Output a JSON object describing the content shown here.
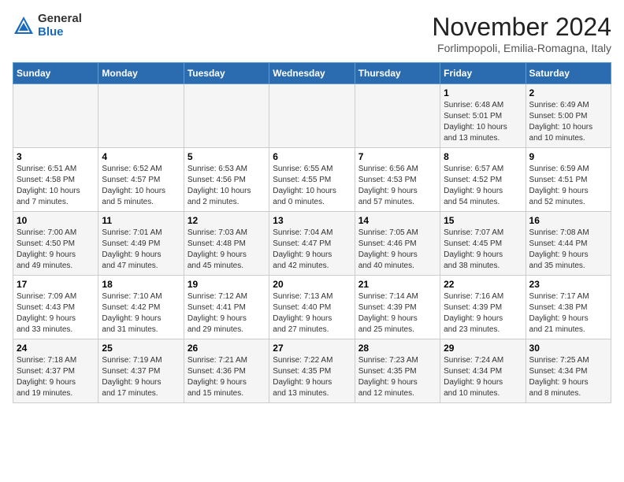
{
  "header": {
    "logo_general": "General",
    "logo_blue": "Blue",
    "month_title": "November 2024",
    "location": "Forlimpopoli, Emilia-Romagna, Italy"
  },
  "days_of_week": [
    "Sunday",
    "Monday",
    "Tuesday",
    "Wednesday",
    "Thursday",
    "Friday",
    "Saturday"
  ],
  "weeks": [
    [
      {
        "day": "",
        "info": ""
      },
      {
        "day": "",
        "info": ""
      },
      {
        "day": "",
        "info": ""
      },
      {
        "day": "",
        "info": ""
      },
      {
        "day": "",
        "info": ""
      },
      {
        "day": "1",
        "info": "Sunrise: 6:48 AM\nSunset: 5:01 PM\nDaylight: 10 hours\nand 13 minutes."
      },
      {
        "day": "2",
        "info": "Sunrise: 6:49 AM\nSunset: 5:00 PM\nDaylight: 10 hours\nand 10 minutes."
      }
    ],
    [
      {
        "day": "3",
        "info": "Sunrise: 6:51 AM\nSunset: 4:58 PM\nDaylight: 10 hours\nand 7 minutes."
      },
      {
        "day": "4",
        "info": "Sunrise: 6:52 AM\nSunset: 4:57 PM\nDaylight: 10 hours\nand 5 minutes."
      },
      {
        "day": "5",
        "info": "Sunrise: 6:53 AM\nSunset: 4:56 PM\nDaylight: 10 hours\nand 2 minutes."
      },
      {
        "day": "6",
        "info": "Sunrise: 6:55 AM\nSunset: 4:55 PM\nDaylight: 10 hours\nand 0 minutes."
      },
      {
        "day": "7",
        "info": "Sunrise: 6:56 AM\nSunset: 4:53 PM\nDaylight: 9 hours\nand 57 minutes."
      },
      {
        "day": "8",
        "info": "Sunrise: 6:57 AM\nSunset: 4:52 PM\nDaylight: 9 hours\nand 54 minutes."
      },
      {
        "day": "9",
        "info": "Sunrise: 6:59 AM\nSunset: 4:51 PM\nDaylight: 9 hours\nand 52 minutes."
      }
    ],
    [
      {
        "day": "10",
        "info": "Sunrise: 7:00 AM\nSunset: 4:50 PM\nDaylight: 9 hours\nand 49 minutes."
      },
      {
        "day": "11",
        "info": "Sunrise: 7:01 AM\nSunset: 4:49 PM\nDaylight: 9 hours\nand 47 minutes."
      },
      {
        "day": "12",
        "info": "Sunrise: 7:03 AM\nSunset: 4:48 PM\nDaylight: 9 hours\nand 45 minutes."
      },
      {
        "day": "13",
        "info": "Sunrise: 7:04 AM\nSunset: 4:47 PM\nDaylight: 9 hours\nand 42 minutes."
      },
      {
        "day": "14",
        "info": "Sunrise: 7:05 AM\nSunset: 4:46 PM\nDaylight: 9 hours\nand 40 minutes."
      },
      {
        "day": "15",
        "info": "Sunrise: 7:07 AM\nSunset: 4:45 PM\nDaylight: 9 hours\nand 38 minutes."
      },
      {
        "day": "16",
        "info": "Sunrise: 7:08 AM\nSunset: 4:44 PM\nDaylight: 9 hours\nand 35 minutes."
      }
    ],
    [
      {
        "day": "17",
        "info": "Sunrise: 7:09 AM\nSunset: 4:43 PM\nDaylight: 9 hours\nand 33 minutes."
      },
      {
        "day": "18",
        "info": "Sunrise: 7:10 AM\nSunset: 4:42 PM\nDaylight: 9 hours\nand 31 minutes."
      },
      {
        "day": "19",
        "info": "Sunrise: 7:12 AM\nSunset: 4:41 PM\nDaylight: 9 hours\nand 29 minutes."
      },
      {
        "day": "20",
        "info": "Sunrise: 7:13 AM\nSunset: 4:40 PM\nDaylight: 9 hours\nand 27 minutes."
      },
      {
        "day": "21",
        "info": "Sunrise: 7:14 AM\nSunset: 4:39 PM\nDaylight: 9 hours\nand 25 minutes."
      },
      {
        "day": "22",
        "info": "Sunrise: 7:16 AM\nSunset: 4:39 PM\nDaylight: 9 hours\nand 23 minutes."
      },
      {
        "day": "23",
        "info": "Sunrise: 7:17 AM\nSunset: 4:38 PM\nDaylight: 9 hours\nand 21 minutes."
      }
    ],
    [
      {
        "day": "24",
        "info": "Sunrise: 7:18 AM\nSunset: 4:37 PM\nDaylight: 9 hours\nand 19 minutes."
      },
      {
        "day": "25",
        "info": "Sunrise: 7:19 AM\nSunset: 4:37 PM\nDaylight: 9 hours\nand 17 minutes."
      },
      {
        "day": "26",
        "info": "Sunrise: 7:21 AM\nSunset: 4:36 PM\nDaylight: 9 hours\nand 15 minutes."
      },
      {
        "day": "27",
        "info": "Sunrise: 7:22 AM\nSunset: 4:35 PM\nDaylight: 9 hours\nand 13 minutes."
      },
      {
        "day": "28",
        "info": "Sunrise: 7:23 AM\nSunset: 4:35 PM\nDaylight: 9 hours\nand 12 minutes."
      },
      {
        "day": "29",
        "info": "Sunrise: 7:24 AM\nSunset: 4:34 PM\nDaylight: 9 hours\nand 10 minutes."
      },
      {
        "day": "30",
        "info": "Sunrise: 7:25 AM\nSunset: 4:34 PM\nDaylight: 9 hours\nand 8 minutes."
      }
    ]
  ]
}
